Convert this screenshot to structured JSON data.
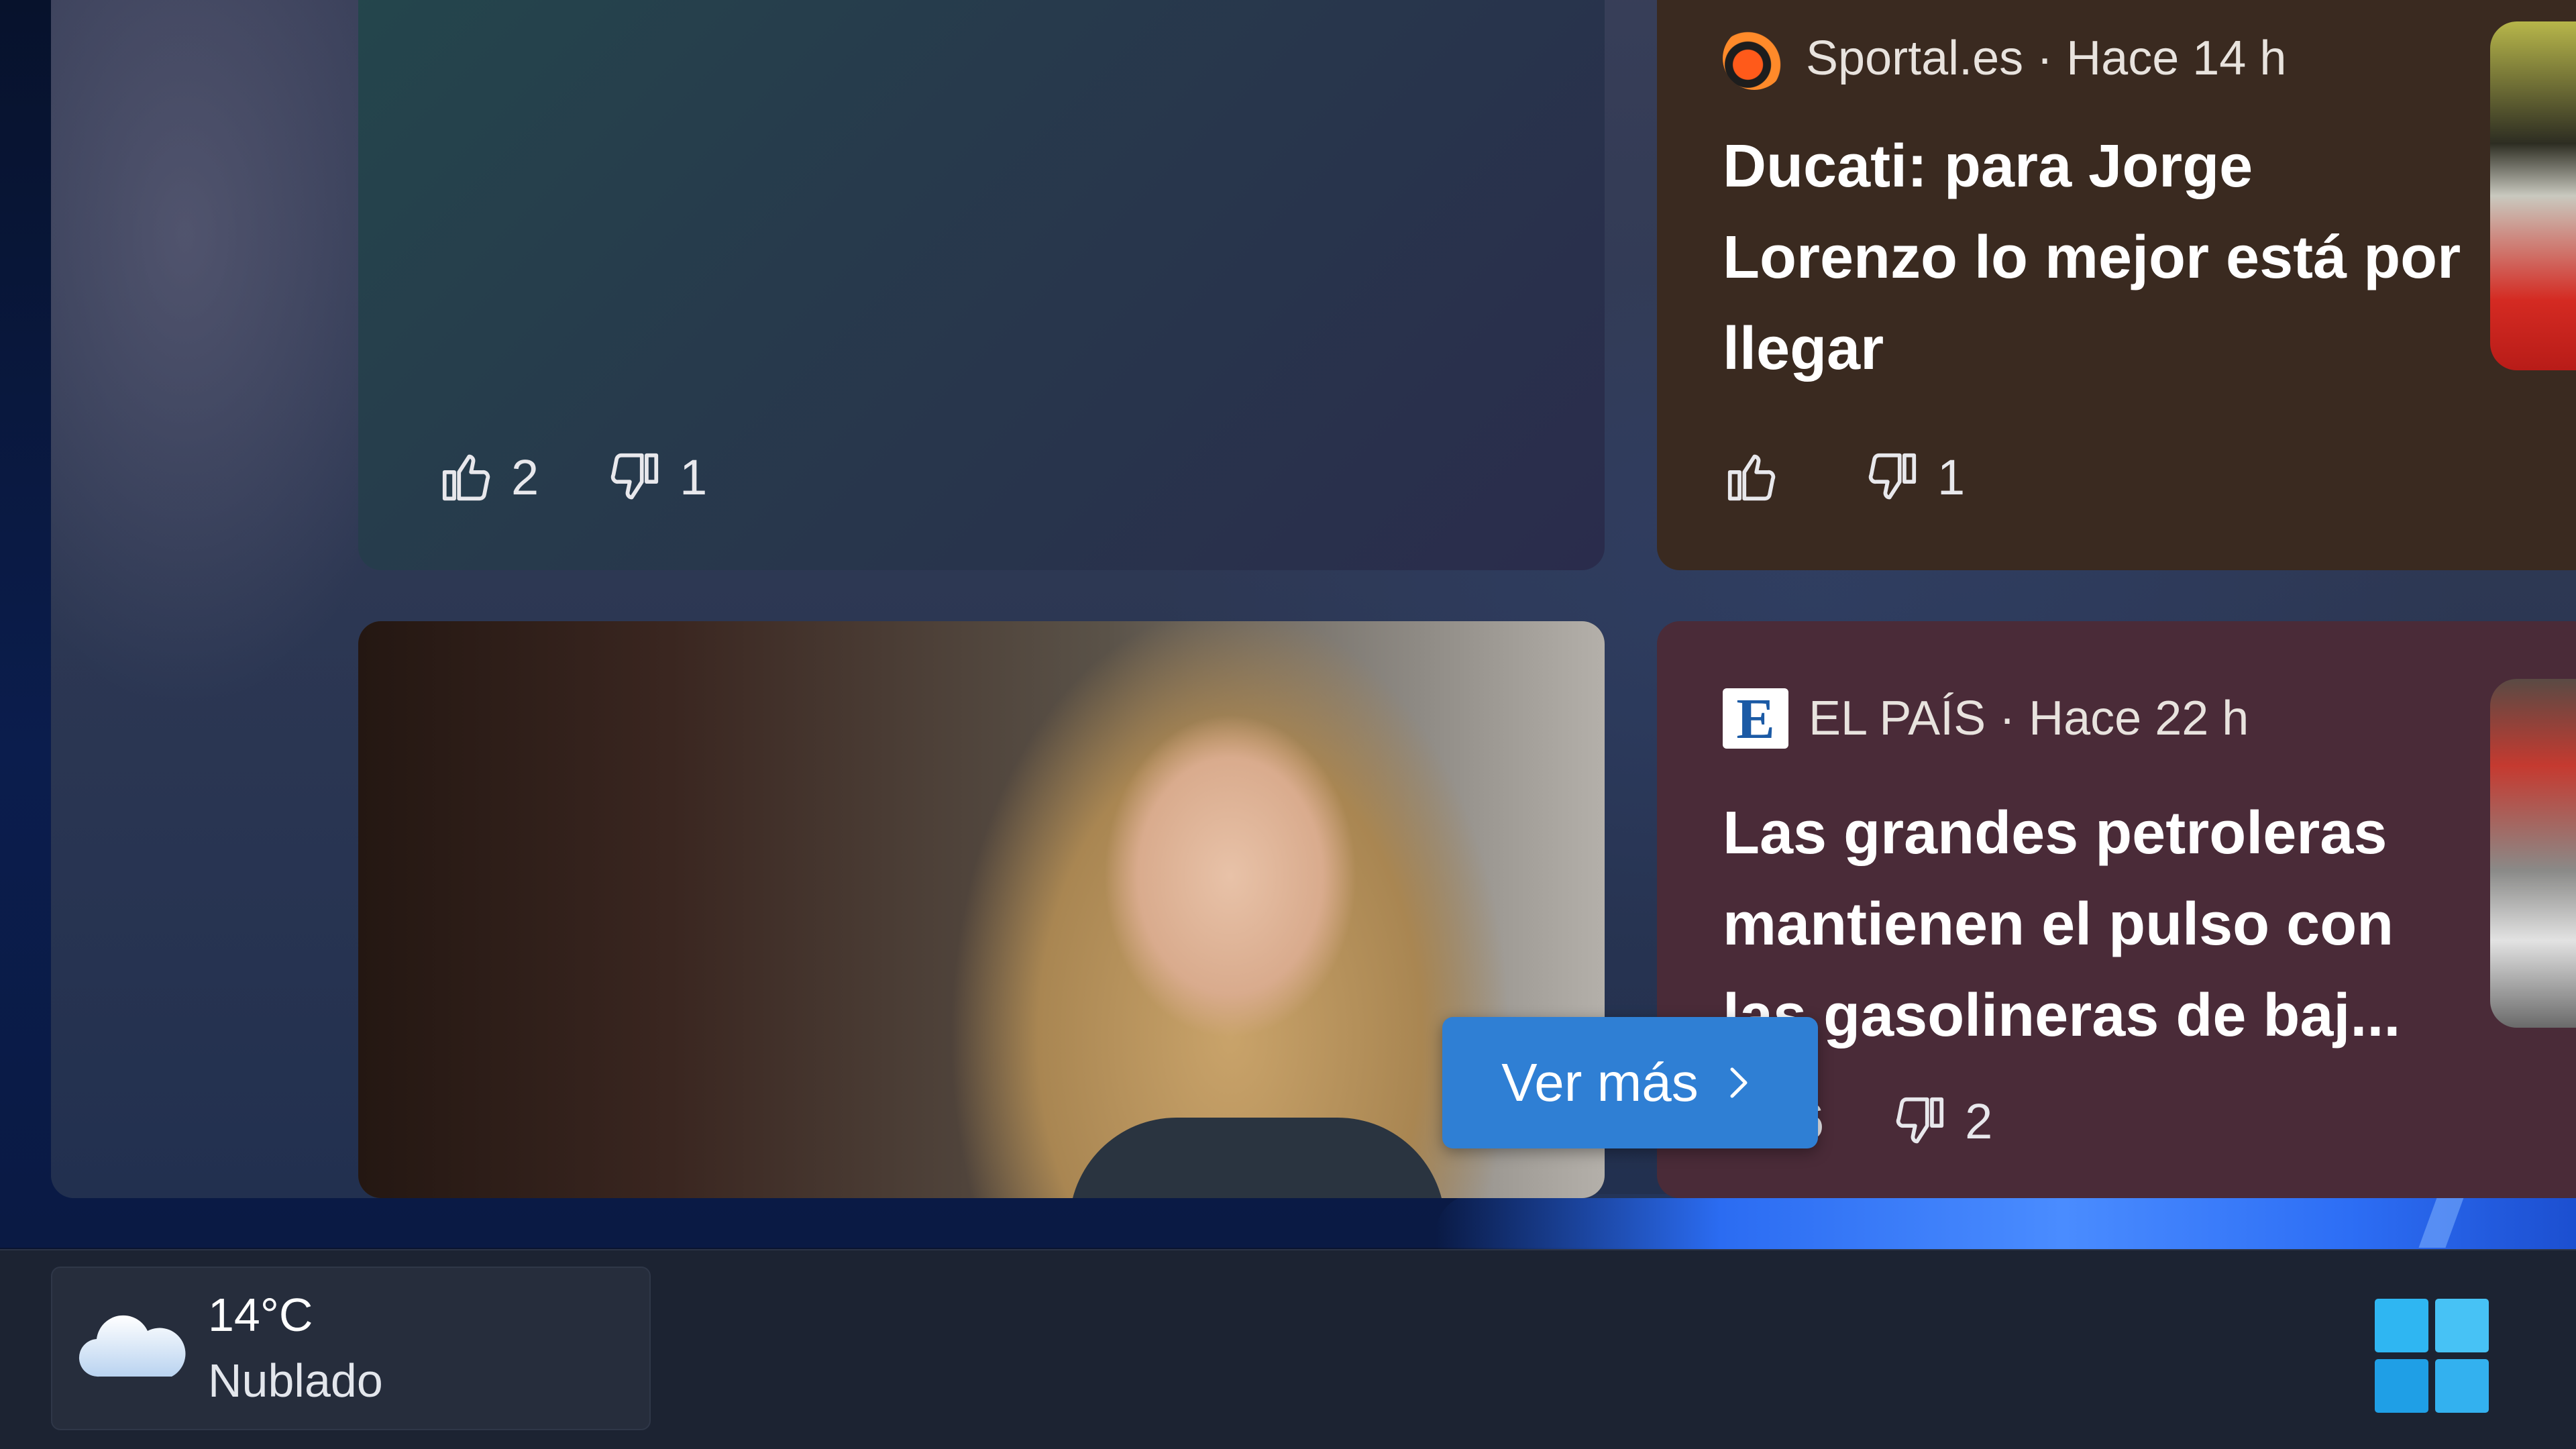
{
  "feed": {
    "cards": [
      {
        "reactions": {
          "likes": "2",
          "dislikes": "1"
        }
      },
      {
        "source": "Sportal.es · Hace 14 h",
        "headline": "Ducati: para Jorge Lorenzo lo mejor está por llegar",
        "reactions": {
          "likes": "",
          "dislikes": "1"
        }
      },
      {
        "image_icon": "portrait-photo"
      },
      {
        "source": "EL PAÍS · Hace 22 h",
        "logo_letter": "E",
        "headline": "Las grandes petroleras mantienen el pulso con las gasolineras de baj...",
        "reactions": {
          "likes": "6",
          "dislikes": "2"
        }
      }
    ],
    "see_more_label": "Ver más"
  },
  "taskbar": {
    "weather": {
      "temperature": "14°C",
      "condition": "Nublado",
      "icon": "cloud-icon"
    },
    "start_icon": "windows-start-icon"
  },
  "colors": {
    "accent": "#2f7fd4",
    "start": "#2fb6f2"
  }
}
